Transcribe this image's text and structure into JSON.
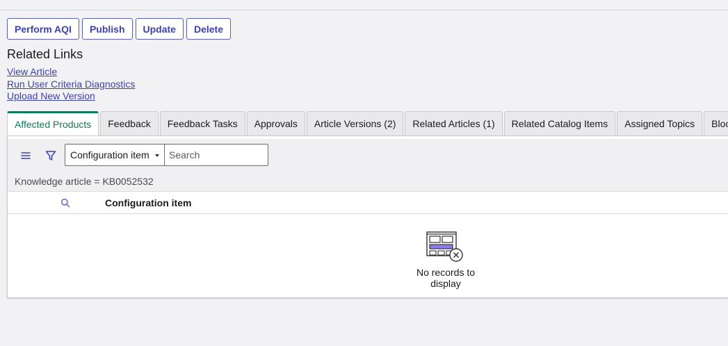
{
  "actions": {
    "perform_aqi": "Perform AQI",
    "publish": "Publish",
    "update": "Update",
    "delete": "Delete"
  },
  "related_links": {
    "title": "Related Links",
    "items": [
      "View Article",
      "Run User Criteria Diagnostics",
      "Upload New Version"
    ]
  },
  "tabs": [
    "Affected Products",
    "Feedback",
    "Feedback Tasks",
    "Approvals",
    "Article Versions (2)",
    "Related Articles (1)",
    "Related Catalog Items",
    "Assigned Topics",
    "Blocks"
  ],
  "toolbar": {
    "field_select_value": "Configuration item",
    "search_placeholder": "Search"
  },
  "breadcrumb": "Knowledge article = KB0052532",
  "table": {
    "columns": [
      "Configuration item"
    ],
    "empty_message": "No records to display"
  },
  "icons": {
    "menu": "hamburger-icon",
    "filter": "filter-icon",
    "column_search": "search-icon",
    "empty": "empty-list-icon"
  },
  "colors": {
    "accent": "#3d42a6",
    "active_tab": "#0e7a5a"
  }
}
